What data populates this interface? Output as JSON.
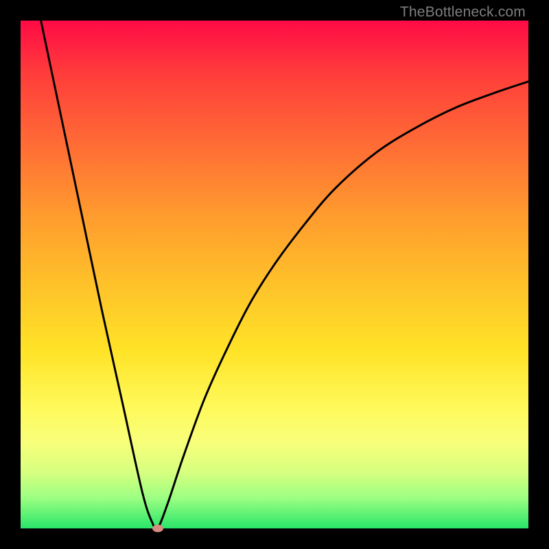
{
  "watermark": "TheBottleneck.com",
  "chart_data": {
    "type": "line",
    "title": "",
    "xlabel": "",
    "ylabel": "",
    "xlim": [
      0,
      100
    ],
    "ylim": [
      0,
      100
    ],
    "series": [
      {
        "name": "left-branch",
        "x": [
          4,
          8,
          12,
          16,
          20,
          24,
          26,
          27
        ],
        "values": [
          100,
          81,
          62,
          43,
          25,
          7,
          1,
          0
        ]
      },
      {
        "name": "right-branch",
        "x": [
          27,
          29,
          32,
          36,
          40,
          45,
          50,
          56,
          62,
          70,
          78,
          86,
          94,
          100
        ],
        "values": [
          0,
          5,
          14,
          25,
          34,
          44,
          52,
          60,
          67,
          74,
          79,
          83,
          86,
          88
        ]
      }
    ],
    "marker": {
      "x": 27,
      "y": 0,
      "color": "#d98a80"
    },
    "background_gradient": {
      "top": "#ff0a46",
      "bottom": "#29e66a"
    }
  }
}
